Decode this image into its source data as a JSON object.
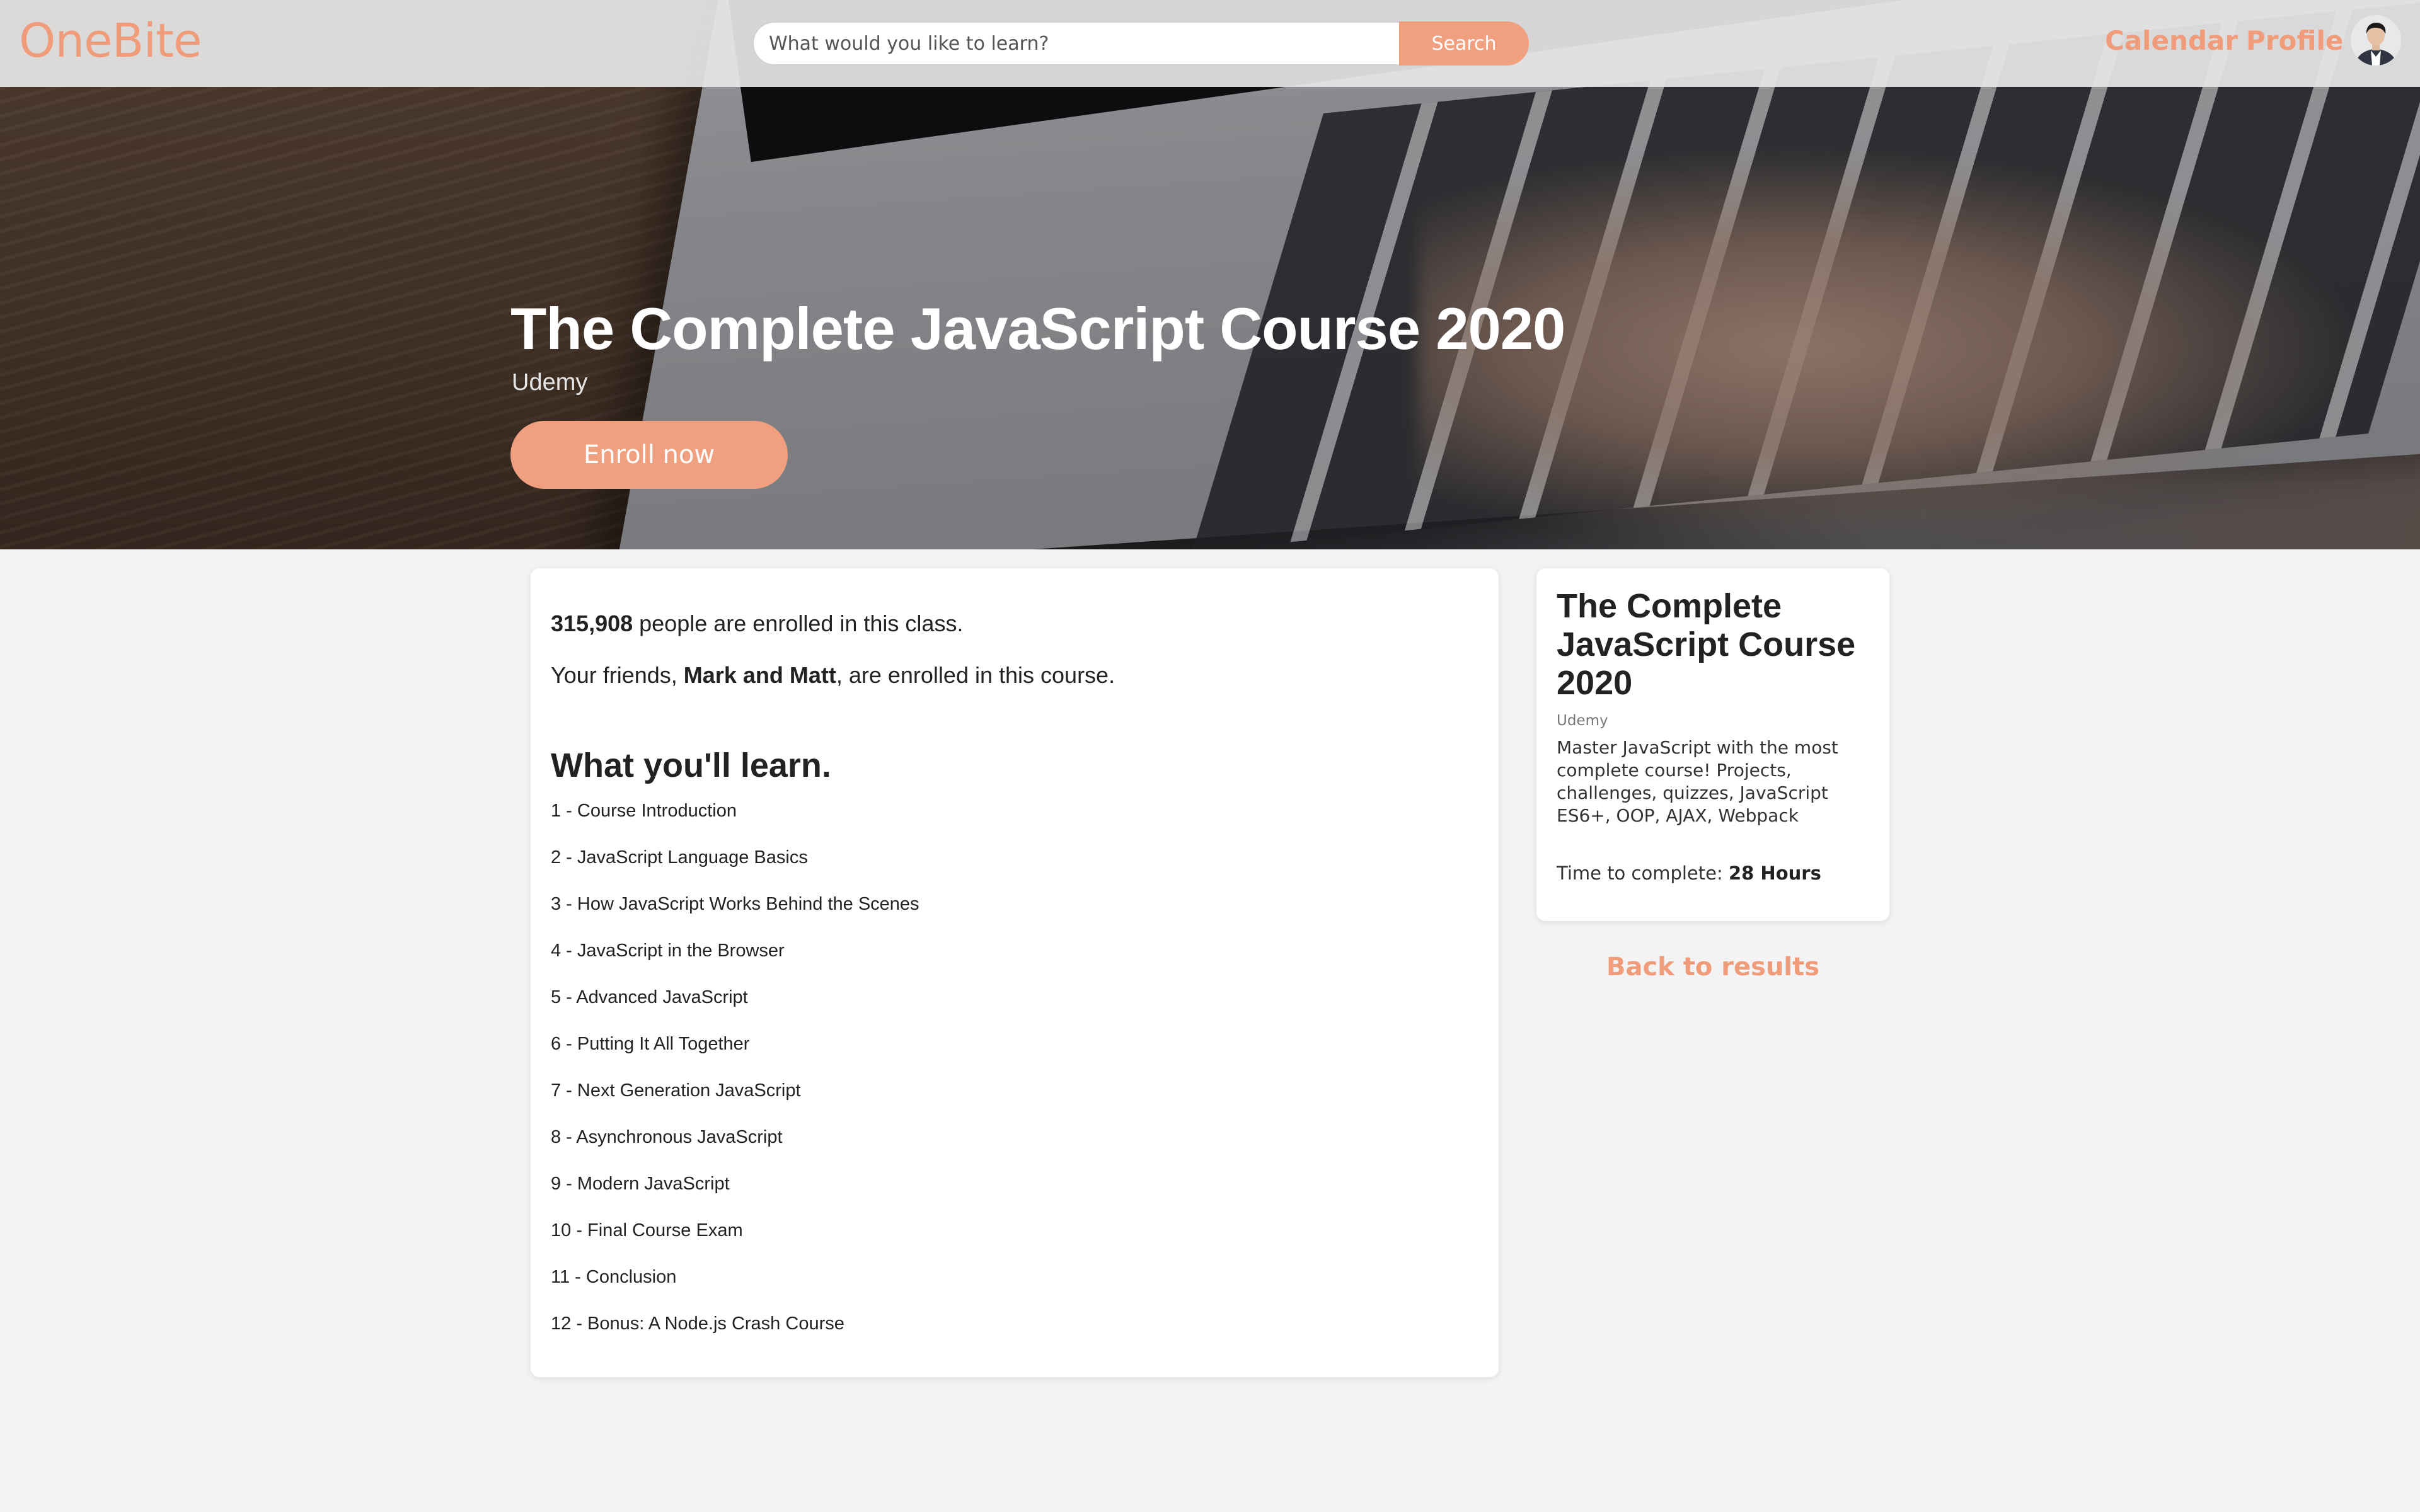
{
  "header": {
    "logo": "OneBite",
    "search_placeholder": "What would you like to learn?",
    "search_button": "Search",
    "nav": {
      "calendar": "Calendar",
      "profile": "Profile"
    }
  },
  "hero": {
    "title": "The Complete JavaScript Course 2020",
    "provider": "Udemy",
    "enroll_button": "Enroll now"
  },
  "main": {
    "enrolled_count": "315,908",
    "enrolled_suffix": " people are enrolled in this class.",
    "friends_prefix": "Your friends, ",
    "friends_names": "Mark and Matt",
    "friends_suffix": ", are enrolled in this course.",
    "learn_heading": "What you'll learn.",
    "lessons": [
      "1 - Course Introduction",
      "2 - JavaScript Language Basics",
      "3 - How JavaScript Works Behind the Scenes",
      "4 - JavaScript in the Browser",
      "5 - Advanced JavaScript",
      "6 - Putting It All Together",
      "7 - Next Generation JavaScript",
      "8 - Asynchronous JavaScript",
      "9 - Modern JavaScript",
      "10 - Final Course Exam",
      "11 - Conclusion",
      "12 - Bonus: A Node.js Crash Course"
    ]
  },
  "sidebar": {
    "title": "The Complete JavaScript Course 2020",
    "provider": "Udemy",
    "description": "Master JavaScript with the most complete course! Projects, challenges, quizzes, JavaScript ES6+, OOP, AJAX, Webpack",
    "time_label": "Time to complete: ",
    "time_value": "28 Hours",
    "back_link": "Back to results"
  },
  "colors": {
    "accent": "#f09b7a",
    "button": "#f0a07f",
    "background": "#f3f3f3"
  },
  "icons": {
    "avatar": "user-avatar-photo"
  }
}
